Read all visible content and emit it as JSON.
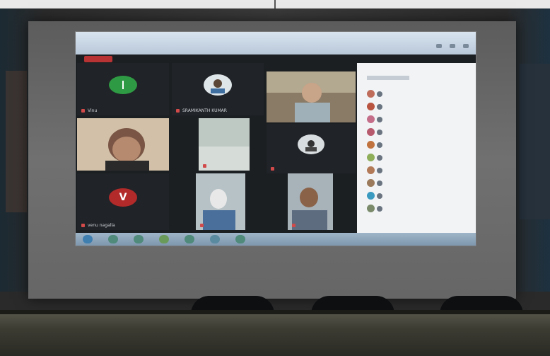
{
  "meeting": {
    "title_lines": [
      "",
      ""
    ],
    "rec_badge": "",
    "tiles": [
      {
        "name": "Vinu",
        "kind": "avatar",
        "avatar_letter": "",
        "avatar_color": "#2f9a44"
      },
      {
        "name": "SRAMIKANTH KUMAR",
        "kind": "avatar-photo",
        "avatar_letter": "",
        "avatar_color": "#dfe6ea"
      },
      {
        "name": "",
        "kind": "video",
        "avatar_letter": "",
        "avatar_color": "#8a7b67"
      },
      {
        "name": "",
        "kind": "video",
        "avatar_letter": "",
        "avatar_color": "#c9b59a"
      },
      {
        "name": "",
        "kind": "video",
        "avatar_letter": "",
        "avatar_color": "#bfc9c4"
      },
      {
        "name": "",
        "kind": "avatar-photo",
        "avatar_letter": "",
        "avatar_color": "#d8dde0"
      },
      {
        "name": "venu nagalla",
        "kind": "avatar",
        "avatar_letter": "V",
        "avatar_color": "#b22a2a"
      },
      {
        "name": "",
        "kind": "video",
        "avatar_letter": "",
        "avatar_color": "#b7c2c7"
      },
      {
        "name": "",
        "kind": "video",
        "avatar_letter": "",
        "avatar_color": "#a8b3b9"
      }
    ],
    "participants_header": "",
    "participant_colors": [
      "#c06c5a",
      "#b8543f",
      "#c56e8a",
      "#b85a6e",
      "#c0733e",
      "#8fae5a",
      "#b37a58",
      "#9a7a5a",
      "#3a9ac0",
      "#7a8a6a"
    ],
    "taskbar_icons": 8
  }
}
